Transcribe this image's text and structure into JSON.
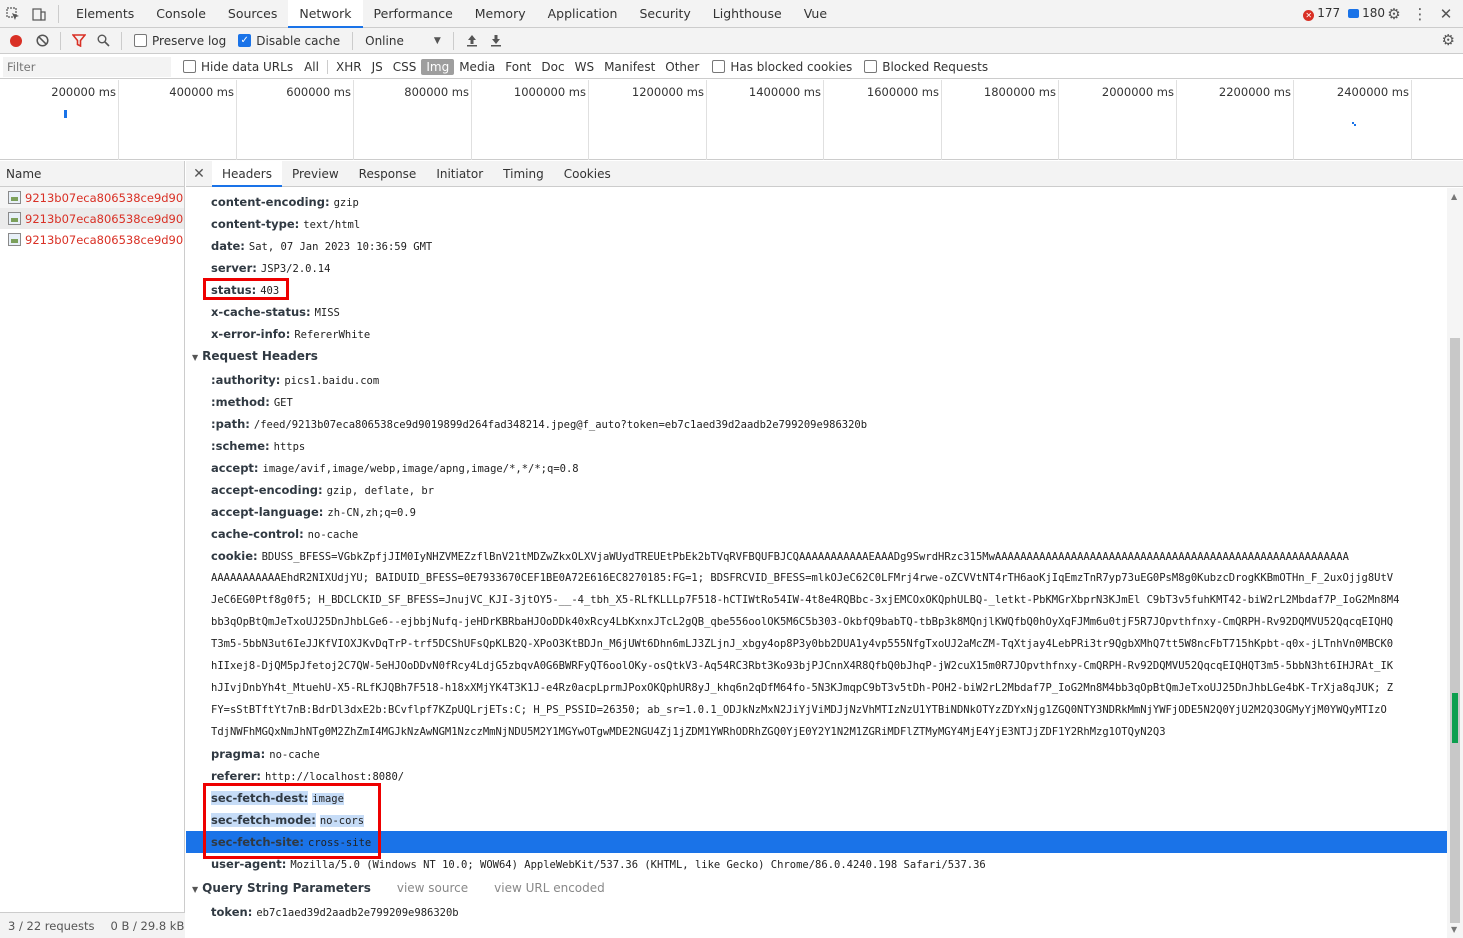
{
  "top_tabs": [
    "Elements",
    "Console",
    "Sources",
    "Network",
    "Performance",
    "Memory",
    "Application",
    "Security",
    "Lighthouse",
    "Vue"
  ],
  "active_top_tab": "Network",
  "counts": {
    "errors": "177",
    "messages": "180"
  },
  "toolbar": {
    "preserve_log": "Preserve log",
    "disable_cache": "Disable cache",
    "throttle": "Online"
  },
  "filterbar": {
    "placeholder": "Filter",
    "hide_data_urls": "Hide data URLs",
    "types": [
      "All",
      "XHR",
      "JS",
      "CSS",
      "Img",
      "Media",
      "Font",
      "Doc",
      "WS",
      "Manifest",
      "Other"
    ],
    "active_type": "Img",
    "has_blocked_cookies": "Has blocked cookies",
    "blocked_requests": "Blocked Requests"
  },
  "overview_ticks": [
    "200000 ms",
    "400000 ms",
    "600000 ms",
    "800000 ms",
    "1000000 ms",
    "1200000 ms",
    "1400000 ms",
    "1600000 ms",
    "1800000 ms",
    "2000000 ms",
    "2200000 ms",
    "2400000 ms"
  ],
  "requests": {
    "header": "Name",
    "items": [
      "9213b07eca806538ce9d90...",
      "9213b07eca806538ce9d90...",
      "9213b07eca806538ce9d90..."
    ]
  },
  "status": {
    "requests": "3 / 22 requests",
    "transfer": "0 B / 29.8 kB t"
  },
  "detail_tabs": [
    "Headers",
    "Preview",
    "Response",
    "Initiator",
    "Timing",
    "Cookies"
  ],
  "active_detail_tab": "Headers",
  "response_headers": [
    {
      "k": "content-encoding:",
      "v": "gzip"
    },
    {
      "k": "content-type:",
      "v": "text/html"
    },
    {
      "k": "date:",
      "v": "Sat, 07 Jan 2023 10:36:59 GMT"
    },
    {
      "k": "server:",
      "v": "JSP3/2.0.14"
    },
    {
      "k": "status:",
      "v": "403"
    },
    {
      "k": "x-cache-status:",
      "v": "MISS"
    },
    {
      "k": "x-error-info:",
      "v": "RefererWhite"
    }
  ],
  "request_headers_title": "Request Headers",
  "request_headers_a": [
    {
      "k": ":authority:",
      "v": "pics1.baidu.com"
    },
    {
      "k": ":method:",
      "v": "GET"
    },
    {
      "k": ":path:",
      "v": "/feed/9213b07eca806538ce9d9019899d264fad348214.jpeg@f_auto?token=eb7c1aed39d2aadb2e799209e986320b"
    },
    {
      "k": ":scheme:",
      "v": "https"
    },
    {
      "k": "accept:",
      "v": "image/avif,image/webp,image/apng,image/*,*/*;q=0.8"
    },
    {
      "k": "accept-encoding:",
      "v": "gzip, deflate, br"
    },
    {
      "k": "accept-language:",
      "v": "zh-CN,zh;q=0.9"
    },
    {
      "k": "cache-control:",
      "v": "no-cache"
    }
  ],
  "cookie": {
    "k": "cookie:",
    "lines": [
      "BDUSS_BFESS=VGbkZpfjJIM0IyNHZVMEZzflBnV21tMDZwZkxOLXVjaWUydTREUEtPbEk2bTVqRVFBQUFBJCQAAAAAAAAAAAEAAADg9SwrdHRzc315MwAAAAAAAAAAAAAAAAAAAAAAAAAAAAAAAAAAAAAAAAAAAAAAAAAAAAAAAA",
      "AAAAAAAAAAAEhdR2NIXUdjYU; BAIDUID_BFESS=0E7933670CEF1BE0A72E616EC8270185:FG=1; BDSFRCVID_BFESS=mlkOJeC62C0LFMrj4rwe-oZCVVtNT4rTH6aoKjIqEmzTnR7yp73uEG0PsM8g0KubzcDrogKKBmOTHn_F_2uxOjjg8UtV",
      "JeC6EG0Ptf8g0f5; H_BDCLCKID_SF_BFESS=JnujVC_KJI-3jtOY5-__-4_tbh_X5-RLfKLLLp7F518-hCTIWtRo54IW-4t8e4RQBbc-3xjEMCOxOKQphULBQ-_letkt-PbKMGrXbprN3KJmEl C9bT3v5fuhKMT42-biW2rL2Mbdaf7P_IoG2Mn8M4",
      "bb3qOpBtQmJeTxoUJ25DnJhbLGe6--ejbbjNufq-jeHDrKBRbaHJOoDDk40xRcy4LbKxnxJTcL2gQB_qbe556oolOK5M6C5b303-OkbfQ9babTQ-tbBp3k8MQnjlKWQfbQ0hOyXqFJMm6u0tjF5R7JOpvthfnxy-CmQRPH-Rv92DQMVU52QqcqEIQHQ",
      "T3m5-5bbN3ut6IeJJKfVIOXJKvDqTrP-trf5DCShUFsQpKLB2Q-XPoO3KtBDJn_M6jUWt6Dhn6mLJ3ZLjnJ_xbgy4op8P3y0bb2DUA1y4vp555NfgTxoUJ2aMcZM-TqXtjay4LebPRi3tr9QgbXMhQ7tt5W8ncFbT715hKpbt-q0x-jLTnhVn0MBCK0",
      "hIIxej8-DjQM5pJfetoj2C7QW-5eHJOoDDvN0fRcy4LdjG5zbqvA0G6BWRFyQT6oolOKy-osQtkV3-Aq54RC3Rbt3Ko93bjPJCnnX4R8QfbQ0bJhqP-jW2cuX15m0R7JOpvthfnxy-CmQRPH-Rv92DQMVU52QqcqEIQHQT3m5-5bbN3ht6IHJRAt_IK",
      "hJIvjDnbYh4t_MtuehU-X5-RLfKJQBh7F518-h18xXMjYK4T3K1J-e4Rz0acpLprmJPoxOKQphUR8yJ_khq6n2qDfM64fo-5N3KJmqpC9bT3v5tDh-POH2-biW2rL2Mbdaf7P_IoG2Mn8M4bb3qOpBtQmJeTxoUJ25DnJhbLGe4bK-TrXja8qJUK; Z",
      "FY=sStBTftYt7nB:BdrDl3dxE2b:BCvflpf7KZpUQLrjETs:C; H_PS_PSSID=26350; ab_sr=1.0.1_ODJkNzMxN2JiYjViMDJjNzVhMTIzNzU1YTBiNDNkOTYzZDYxNjg1ZGQ0NTY3NDRkMmNjYWFjODE5N2Q0YjU2M2Q3OGMyYjM0YWQyMTIzO",
      "TdjNWFhMGQxNmJhNTg0M2ZhZmI4MGJkNzAwNGM1NzczMmNjNDU5M2Y1MGYwOTgwMDE2NGU4Zj1jZDM1YWRhODRhZGQ0YjE0Y2Y1N2M1ZGRiMDFlZTMyMGY4MjE4YjE3NTJjZDF1Y2RhMzg1OTQyN2Q3"
    ]
  },
  "request_headers_b": [
    {
      "k": "pragma:",
      "v": "no-cache"
    },
    {
      "k": "referer:",
      "v": "http://localhost:8080/"
    },
    {
      "k": "sec-fetch-dest:",
      "v": "image"
    },
    {
      "k": "sec-fetch-mode:",
      "v": "no-cors"
    },
    {
      "k": "sec-fetch-site:",
      "v": "cross-site"
    },
    {
      "k": "user-agent:",
      "v": "Mozilla/5.0 (Windows NT 10.0; WOW64) AppleWebKit/537.36 (KHTML, like Gecko) Chrome/86.0.4240.198 Safari/537.36"
    }
  ],
  "query": {
    "title": "Query String Parameters",
    "view_source": "view source",
    "view_url_encoded": "view URL encoded",
    "k": "token:",
    "v": "eb7c1aed39d2aadb2e799209e986320b"
  },
  "colors": {
    "accent": "#1a73e8",
    "error": "#d93025",
    "highlight_box": "#e00000"
  }
}
